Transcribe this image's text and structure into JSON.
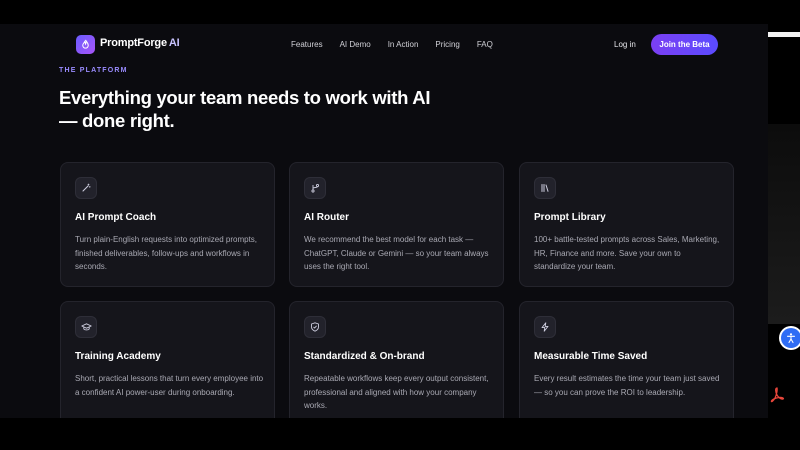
{
  "brand": {
    "name": "PromptForge",
    "suffix": "AI"
  },
  "nav": {
    "links": [
      "Features",
      "AI Demo",
      "In Action",
      "Pricing",
      "FAQ"
    ],
    "login": "Log in",
    "cta": "Join the Beta"
  },
  "section": {
    "eyebrow": "THE PLATFORM",
    "headline_line1": "Everything your team needs to work with AI",
    "headline_line2": "— done right."
  },
  "cards": [
    {
      "icon": "wand-icon",
      "title": "AI Prompt Coach",
      "desc": "Turn plain-English requests into optimized prompts, finished deliverables, follow-ups and workflows in seconds."
    },
    {
      "icon": "branch-icon",
      "title": "AI Router",
      "desc": "We recommend the best model for each task — ChatGPT, Claude or Gemini — so your team always uses the right tool."
    },
    {
      "icon": "library-icon",
      "title": "Prompt Library",
      "desc": "100+ battle-tested prompts across Sales, Marketing, HR, Finance and more. Save your own to standardize your team."
    },
    {
      "icon": "graduation-cap-icon",
      "title": "Training Academy",
      "desc": "Short, practical lessons that turn every employee into a confident AI power-user during onboarding."
    },
    {
      "icon": "shield-icon",
      "title": "Standardized & On-brand",
      "desc": "Repeatable workflows keep every output consistent, professional and aligned with how your company works."
    },
    {
      "icon": "bolt-icon",
      "title": "Measurable Time Saved",
      "desc": "Every result estimates the time your team just saved — so you can prove the ROI to leadership."
    }
  ],
  "colors": {
    "accent": "#7b3ff2",
    "eyebrow": "#9a8cff",
    "background": "#0b0b0f",
    "card": "#15151b"
  }
}
